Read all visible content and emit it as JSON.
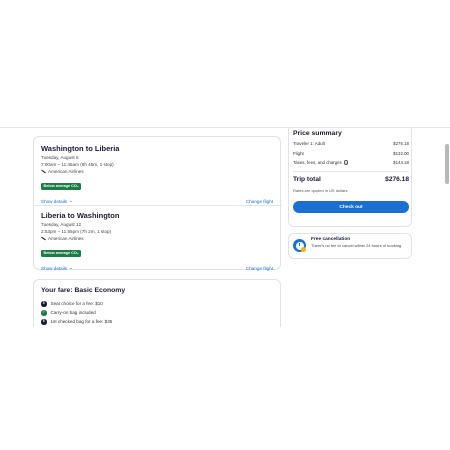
{
  "flights": [
    {
      "title": "Washington to Liberia",
      "date": "Tuesday, August 5",
      "time": "7:00am – 11:45am (6h 45m, 1 stop)",
      "airline": "American Airlines",
      "badge": "Below average CO₂",
      "details_link": "Show details",
      "change_link": "Change flight"
    },
    {
      "title": "Liberia to Washington",
      "date": "Tuesday, August 12",
      "time": "2:53pm – 11:55pm (7h 2m, 1 stop)",
      "airline": "American Airlines",
      "badge": "Below average CO₂",
      "details_link": "Show details",
      "change_link": "Change flight"
    }
  ],
  "fare": {
    "title": "Your fare: Basic Economy",
    "items": [
      {
        "icon": "dollar-icon",
        "text": "Seat choice for a fee: $10"
      },
      {
        "icon": "check-icon",
        "text": "Carry-on bag included"
      },
      {
        "icon": "dollar-icon",
        "text": "1st checked bag for a fee: $35"
      }
    ]
  },
  "price_summary": {
    "title": "Price summary",
    "traveler_label": "Traveler 1: Adult",
    "traveler_value": "$276.18",
    "flight_label": "Flight",
    "flight_value": "$132.00",
    "taxes_label": "Taxes, fees, and charges",
    "taxes_value": "$144.18",
    "trip_total_label": "Trip total",
    "trip_total_value": "$276.18",
    "note": "Rates are quoted in US dollars",
    "checkout_label": "Check out"
  },
  "cancellation": {
    "title": "Free cancellation",
    "text": "There's no fee to cancel within 24 hours of booking."
  },
  "colors": {
    "accent": "#1a6fd1",
    "badge_green": "#1e7a46",
    "text": "#1a1a2e"
  }
}
